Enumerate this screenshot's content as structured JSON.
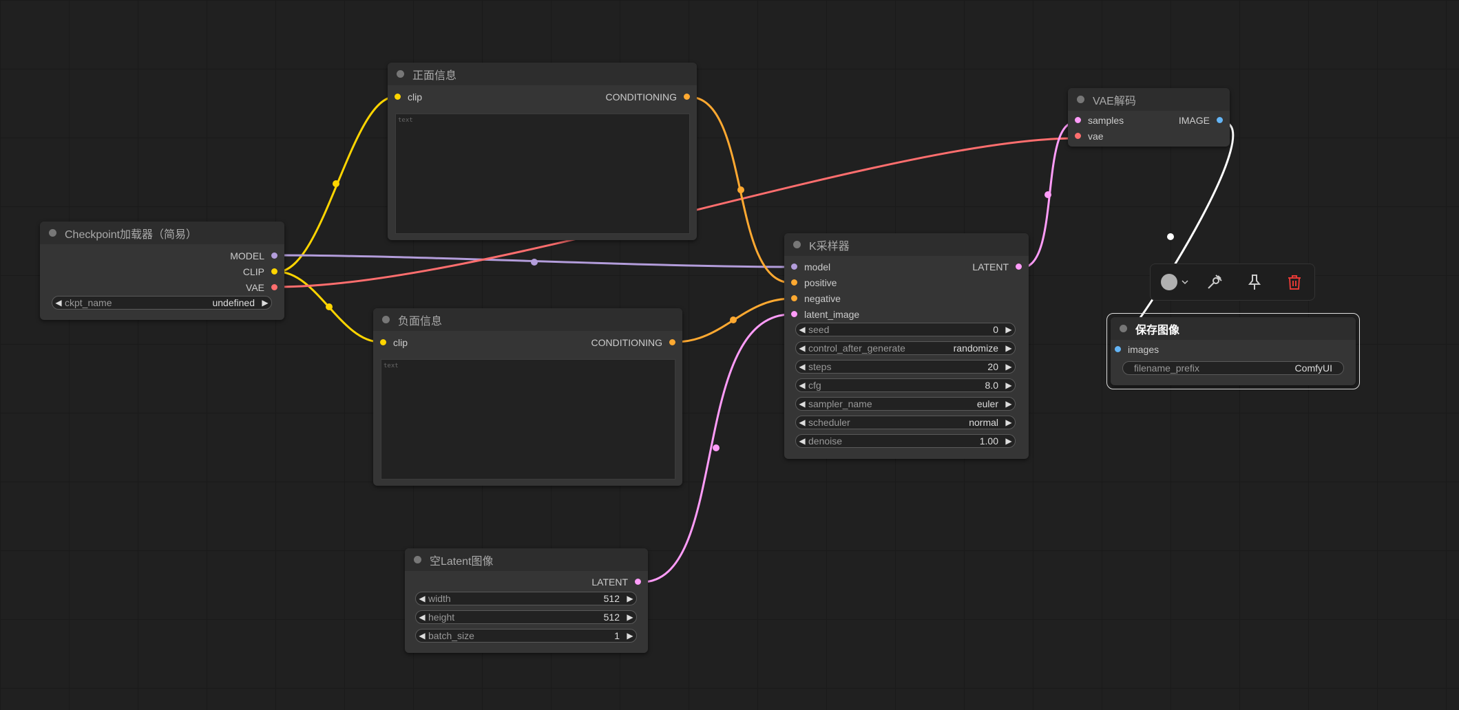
{
  "nodes": {
    "checkpoint": {
      "title": "Checkpoint加载器（简易）",
      "outputs": [
        "MODEL",
        "CLIP",
        "VAE"
      ],
      "widget": {
        "name": "ckpt_name",
        "value": "undefined"
      }
    },
    "positive": {
      "title": "正面信息",
      "input": "clip",
      "output": "CONDITIONING",
      "placeholder": "text"
    },
    "negative": {
      "title": "负面信息",
      "input": "clip",
      "output": "CONDITIONING",
      "placeholder": "text"
    },
    "ksampler": {
      "title": "K采样器",
      "inputs": [
        "model",
        "positive",
        "negative",
        "latent_image"
      ],
      "output": "LATENT",
      "widgets": [
        {
          "name": "seed",
          "value": "0"
        },
        {
          "name": "control_after_generate",
          "value": "randomize"
        },
        {
          "name": "steps",
          "value": "20"
        },
        {
          "name": "cfg",
          "value": "8.0"
        },
        {
          "name": "sampler_name",
          "value": "euler"
        },
        {
          "name": "scheduler",
          "value": "normal"
        },
        {
          "name": "denoise",
          "value": "1.00"
        }
      ]
    },
    "vae_decode": {
      "title": "VAE解码",
      "inputs": [
        "samples",
        "vae"
      ],
      "output": "IMAGE"
    },
    "save_image": {
      "title": "保存图像",
      "input": "images",
      "widget": {
        "name": "filename_prefix",
        "value": "ComfyUI"
      }
    },
    "empty_latent": {
      "title": "空Latent图像",
      "output": "LATENT",
      "widgets": [
        {
          "name": "width",
          "value": "512"
        },
        {
          "name": "height",
          "value": "512"
        },
        {
          "name": "batch_size",
          "value": "1"
        }
      ]
    }
  },
  "toolbar": {
    "icons": [
      "color-picker-icon",
      "chevron-down-icon",
      "bypass-icon",
      "pin-icon",
      "trash-icon"
    ]
  },
  "colors": {
    "model": "#b39ddb",
    "clip": "#ffd500",
    "vae": "#ff6e6e",
    "conditioning": "#ffa931",
    "latent": "#ff9cf9",
    "image": "#64b5f6",
    "delete": "#e53935"
  }
}
